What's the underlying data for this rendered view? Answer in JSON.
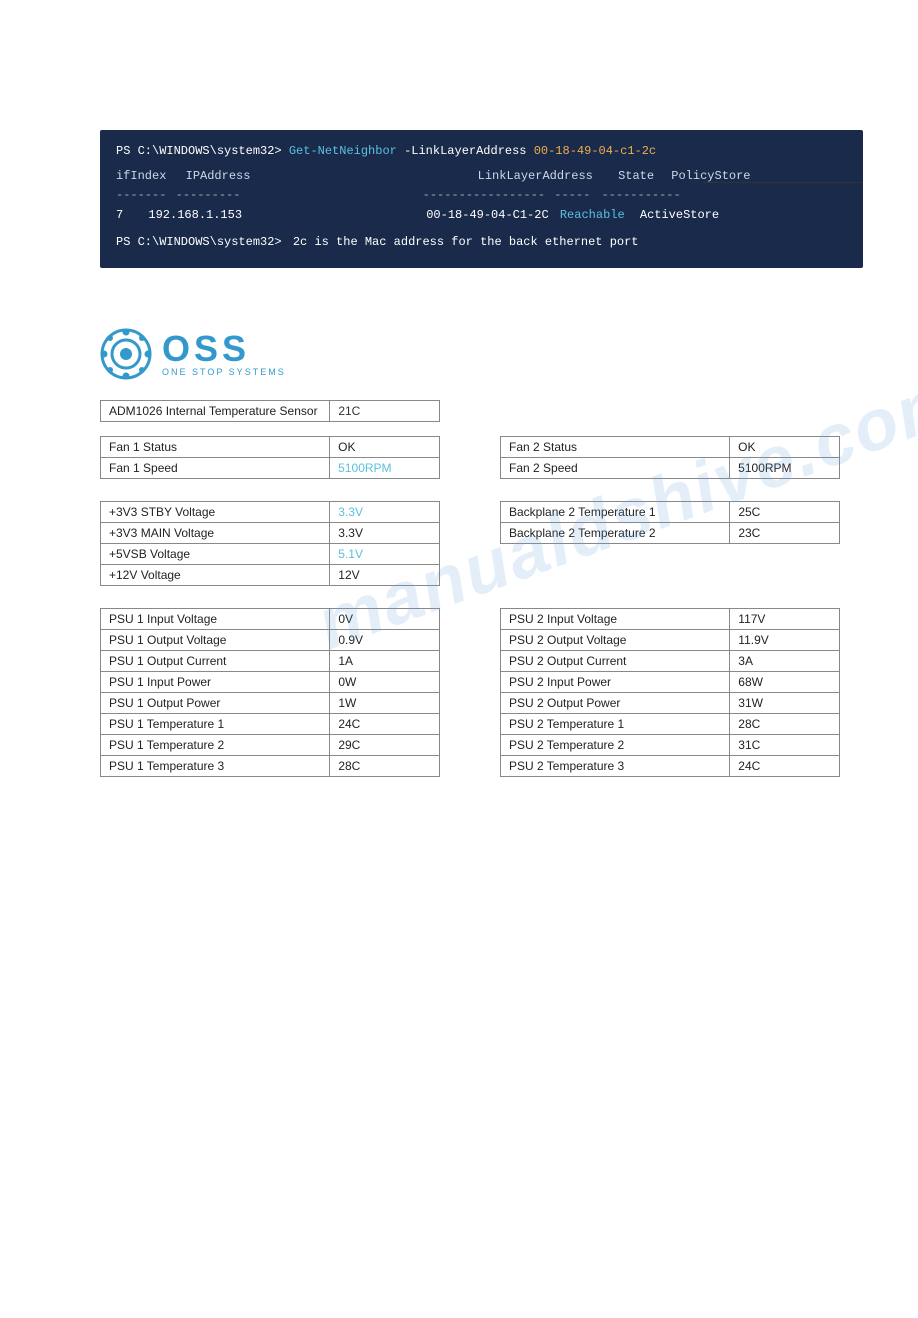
{
  "topRule": true,
  "watermark": "manualdshive.com",
  "terminal": {
    "line1_prompt": "PS C:\\WINDOWS\\system32>",
    "line1_cmd": "Get-NetNeighbor",
    "line1_param1": "-LinkLayerAddress",
    "line1_param2": "00-18-49-04-c1-2c",
    "header_ifIndex": "ifIndex",
    "header_ip": "IPAddress",
    "header_lla": "LinkLayerAddress",
    "header_state": "State",
    "header_policy": "PolicyStore",
    "sep1": "-------",
    "sep2": "---------",
    "sep3": "-----------------",
    "sep4": "-----",
    "sep5": "-----------",
    "data_ifIndex": "7",
    "data_ip": "192.168.1.153",
    "data_lla": "00-18-49-04-C1-2C",
    "data_state": "Reachable",
    "data_policy": "ActiveStore",
    "line3_prompt": "PS C:\\WINDOWS\\system32>",
    "line3_comment": "2c is the Mac address for the back ethernet port"
  },
  "logo": {
    "oss": "OSS",
    "tagline": "ONE STOP SYSTEMS"
  },
  "tables": {
    "adm": {
      "label": "ADM1026 Internal Temperature Sensor",
      "value": "21C"
    },
    "fan1": [
      {
        "label": "Fan 1 Status",
        "value": "OK"
      },
      {
        "label": "Fan 1 Speed",
        "value": "5100RPM"
      }
    ],
    "fan2": [
      {
        "label": "Fan 2 Status",
        "value": "OK"
      },
      {
        "label": "Fan 2 Speed",
        "value": "5100RPM"
      }
    ],
    "voltages": [
      {
        "label": "+3V3 STBY Voltage",
        "value": "3.3V"
      },
      {
        "label": "+3V3 MAIN Voltage",
        "value": "3.3V"
      },
      {
        "label": "+5VSB Voltage",
        "value": "5.1V"
      },
      {
        "label": "+12V Voltage",
        "value": "12V"
      }
    ],
    "backplane": [
      {
        "label": "Backplane 2 Temperature 1",
        "value": "25C"
      },
      {
        "label": "Backplane 2 Temperature 2",
        "value": "23C"
      }
    ],
    "psu1": [
      {
        "label": "PSU 1 Input Voltage",
        "value": "0V"
      },
      {
        "label": "PSU 1 Output Voltage",
        "value": "0.9V"
      },
      {
        "label": "PSU 1 Output Current",
        "value": "1A"
      },
      {
        "label": "PSU 1 Input Power",
        "value": "0W"
      },
      {
        "label": "PSU 1 Output Power",
        "value": "1W"
      },
      {
        "label": "PSU 1 Temperature 1",
        "value": "24C"
      },
      {
        "label": "PSU 1 Temperature 2",
        "value": "29C"
      },
      {
        "label": "PSU 1 Temperature 3",
        "value": "28C"
      }
    ],
    "psu2": [
      {
        "label": "PSU 2 Input Voltage",
        "value": "117V"
      },
      {
        "label": "PSU 2 Output Voltage",
        "value": "11.9V"
      },
      {
        "label": "PSU 2 Output Current",
        "value": "3A"
      },
      {
        "label": "PSU 2 Input Power",
        "value": "68W"
      },
      {
        "label": "PSU 2 Output Power",
        "value": "31W"
      },
      {
        "label": "PSU 2 Temperature 1",
        "value": "28C"
      },
      {
        "label": "PSU 2 Temperature 2",
        "value": "31C"
      },
      {
        "label": "PSU 2 Temperature 3",
        "value": "24C"
      }
    ]
  }
}
